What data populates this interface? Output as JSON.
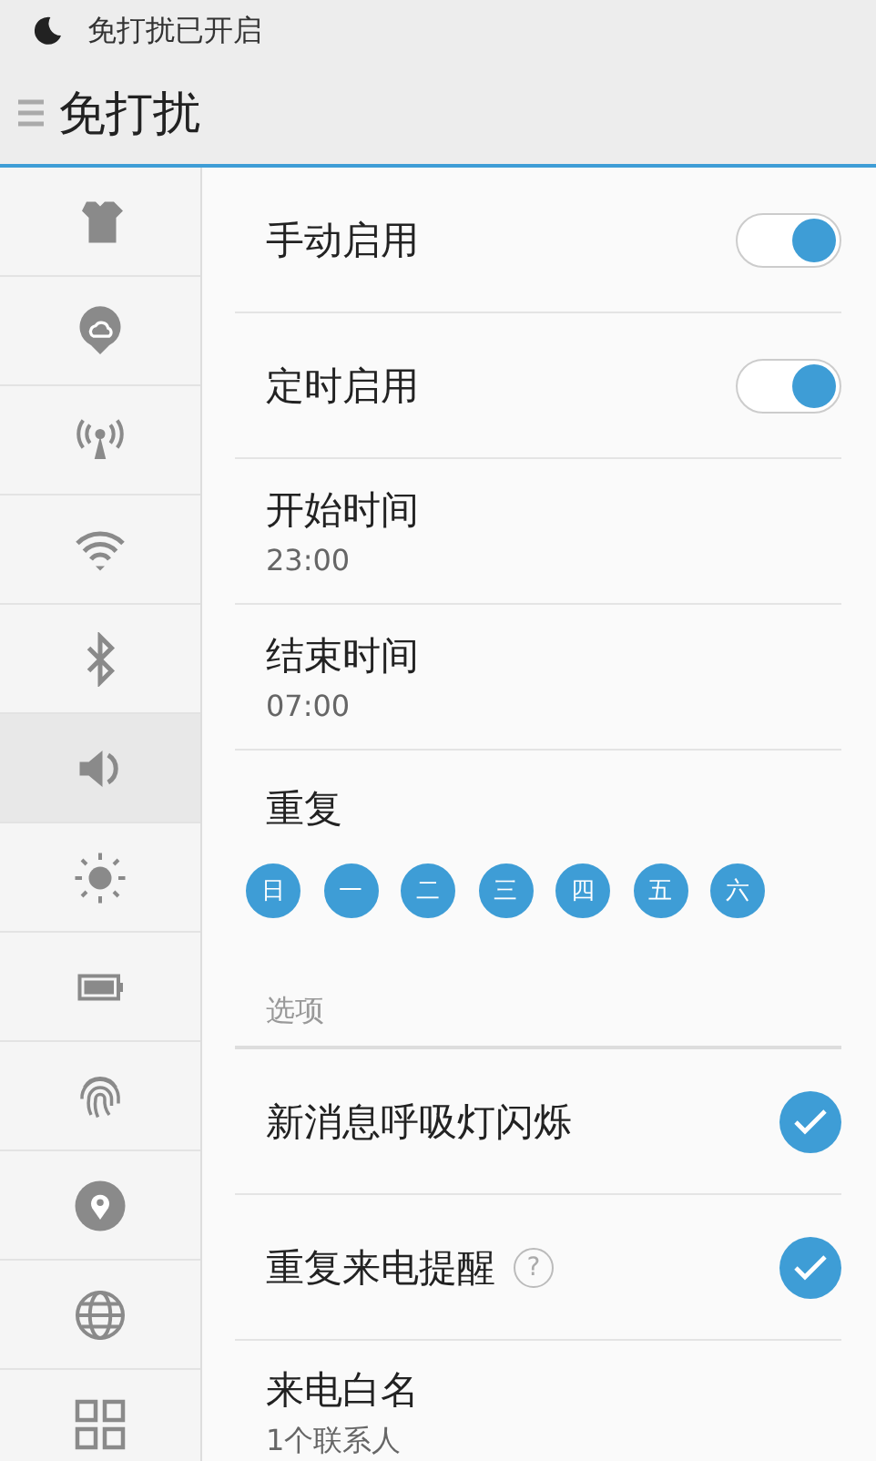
{
  "status_bar": {
    "text": "免打扰已开启"
  },
  "header": {
    "title": "免打扰"
  },
  "sidebar": {
    "items": [
      {
        "kind": "shirt",
        "selected": false
      },
      {
        "kind": "cloud",
        "selected": false
      },
      {
        "kind": "antenna",
        "selected": false
      },
      {
        "kind": "wifi",
        "selected": false
      },
      {
        "kind": "bluetooth",
        "selected": false
      },
      {
        "kind": "speaker",
        "selected": true
      },
      {
        "kind": "sun",
        "selected": false
      },
      {
        "kind": "battery",
        "selected": false
      },
      {
        "kind": "fingerprint",
        "selected": false
      },
      {
        "kind": "pin",
        "selected": false
      },
      {
        "kind": "globe",
        "selected": false
      },
      {
        "kind": "grid",
        "selected": false
      }
    ]
  },
  "settings": [
    {
      "kind": "toggle",
      "label": "手动启用",
      "on": true
    },
    {
      "kind": "toggle",
      "label": "定时启用",
      "on": true
    },
    {
      "kind": "value",
      "label": "开始时间",
      "value": "23:00"
    },
    {
      "kind": "value",
      "label": "结束时间",
      "value": "07:00"
    },
    {
      "kind": "days",
      "label": "重复",
      "days": [
        {
          "label": "日",
          "selected": true
        },
        {
          "label": "一",
          "selected": true
        },
        {
          "label": "二",
          "selected": true
        },
        {
          "label": "三",
          "selected": true
        },
        {
          "label": "四",
          "selected": true
        },
        {
          "label": "五",
          "selected": true
        },
        {
          "label": "六",
          "selected": true
        }
      ]
    },
    {
      "kind": "section",
      "label": "选项"
    },
    {
      "kind": "check",
      "label": "新消息呼吸灯闪烁",
      "checked": true
    },
    {
      "kind": "check",
      "label": "重复来电提醒",
      "checked": true,
      "help": "?"
    },
    {
      "kind": "value",
      "label": "来电白名",
      "value": "1个联系人"
    }
  ]
}
